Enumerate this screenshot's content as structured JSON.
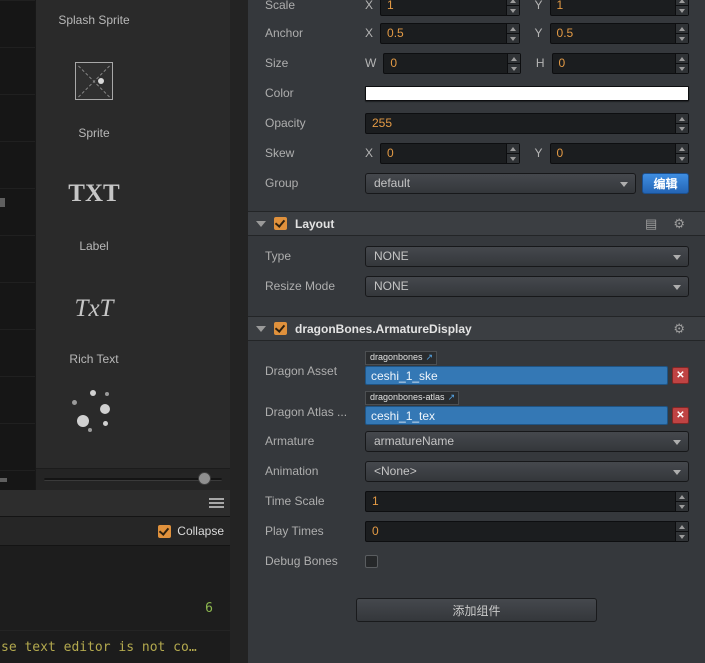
{
  "colors": {
    "color_swatch": "#ffffff",
    "accent_orange": "#e39a45",
    "selected_blue": "#3478b5",
    "remove_red": "#bf4343",
    "button_blue": "#2d7fd1",
    "checkbox_orange": "#e0913c",
    "count_green": "#8db84f",
    "status_yellow": "#b3a94e"
  },
  "icons": {
    "gear": "⚙",
    "doc": "▤",
    "link": "↗",
    "close": "✕"
  },
  "asset_panel": {
    "splash_label": "Splash Sprite",
    "sprite_label": "Sprite",
    "label_icon_text": "TXT",
    "label_label": "Label",
    "richtext_icon_text": "TxT",
    "richtext_label": "Rich Text"
  },
  "console": {
    "collapse_label": "Collapse",
    "line_count": "6",
    "status_text": "se text editor is not co…"
  },
  "inspector": {
    "scale": {
      "label": "Scale",
      "x_label": "X",
      "x_value": "1",
      "y_label": "Y",
      "y_value": "1"
    },
    "anchor": {
      "label": "Anchor",
      "x_label": "X",
      "x_value": "0.5",
      "y_label": "Y",
      "y_value": "0.5"
    },
    "size": {
      "label": "Size",
      "w_label": "W",
      "w_value": "0",
      "h_label": "H",
      "h_value": "0"
    },
    "color": {
      "label": "Color",
      "value": "#ffffff"
    },
    "opacity": {
      "label": "Opacity",
      "value": "255"
    },
    "skew": {
      "label": "Skew",
      "x_label": "X",
      "x_value": "0",
      "y_label": "Y",
      "y_value": "0"
    },
    "group": {
      "label": "Group",
      "value": "default",
      "edit_button": "编辑"
    },
    "layout": {
      "title": "Layout",
      "type_label": "Type",
      "type_value": "NONE",
      "resize_label": "Resize Mode",
      "resize_value": "NONE"
    },
    "dragonbones": {
      "title": "dragonBones.ArmatureDisplay",
      "asset_label": "Dragon Asset",
      "asset_tag": "dragonbones",
      "asset_value": "ceshi_1_ske",
      "atlas_label": "Dragon Atlas ...",
      "atlas_tag": "dragonbones-atlas",
      "atlas_value": "ceshi_1_tex",
      "armature_label": "Armature",
      "armature_value": "armatureName",
      "animation_label": "Animation",
      "animation_value": "<None>",
      "timescale_label": "Time Scale",
      "timescale_value": "1",
      "playtimes_label": "Play Times",
      "playtimes_value": "0",
      "debugbones_label": "Debug Bones"
    },
    "add_component_button": "添加组件"
  }
}
